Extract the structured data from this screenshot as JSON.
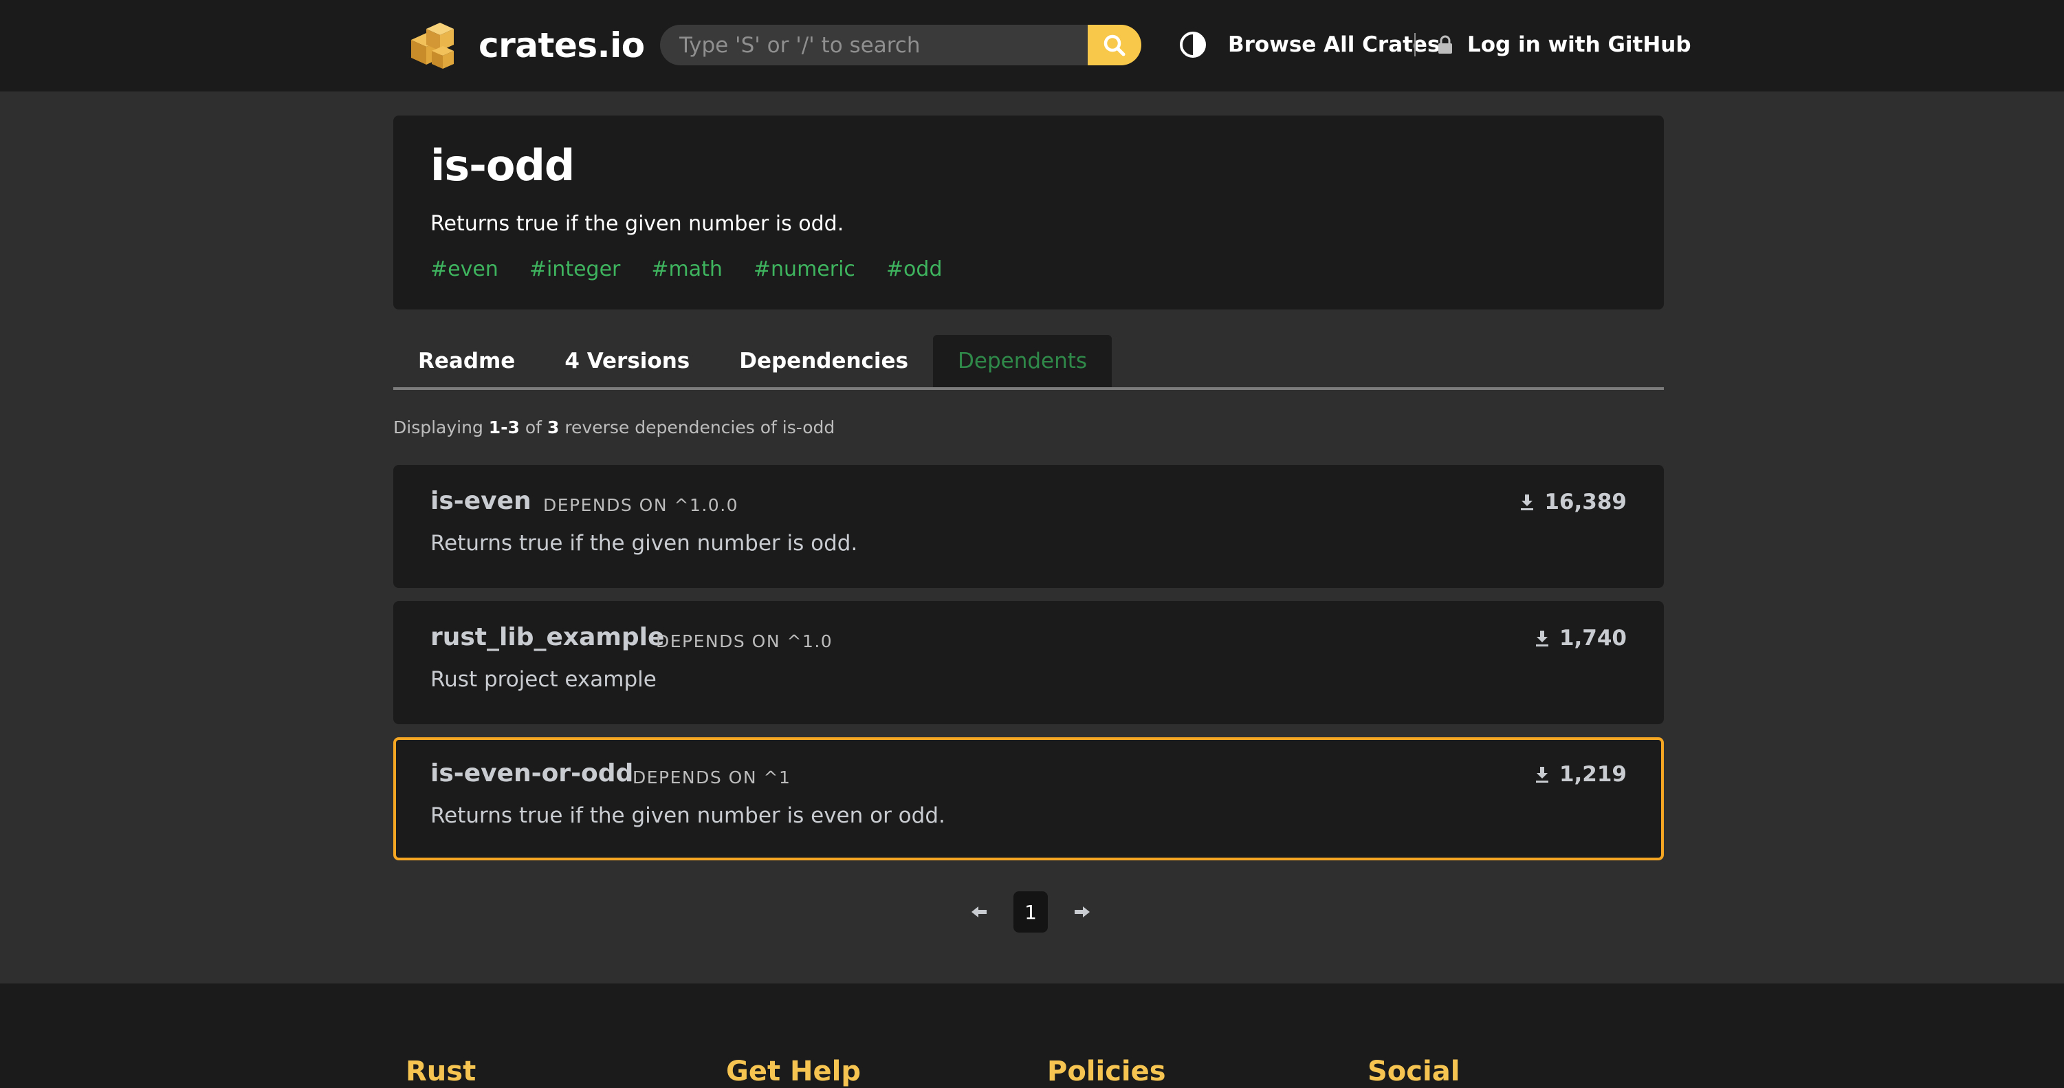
{
  "header": {
    "brand": "crates.io",
    "search_placeholder": "Type 'S' or '/' to search",
    "browse_label": "Browse All Crates",
    "login_label": "Log in with GitHub"
  },
  "crate": {
    "name": "is-odd",
    "description": "Returns true if the given number is odd.",
    "keywords": [
      "#even",
      "#integer",
      "#math",
      "#numeric",
      "#odd"
    ]
  },
  "tabs": [
    {
      "label": "Readme"
    },
    {
      "label": "4 Versions"
    },
    {
      "label": "Dependencies"
    },
    {
      "label": "Dependents",
      "active": true
    }
  ],
  "summary": {
    "prefix": "Displaying",
    "range": "1-3",
    "of": "of",
    "total": "3",
    "suffix": "reverse dependencies of is-odd"
  },
  "dependents": [
    {
      "name": "is-even",
      "requirement": "DEPENDS ON ^1.0.0",
      "description": "Returns true if the given number is odd.",
      "downloads": "16,389"
    },
    {
      "name": "rust_lib_example",
      "requirement": "DEPENDS ON ^1.0",
      "description": "Rust project example",
      "downloads": "1,740"
    },
    {
      "name": "is-even-or-odd",
      "requirement": "DEPENDS ON ^1",
      "description": "Returns true if the given number is even or odd.",
      "downloads": "1,219",
      "focused": true
    }
  ],
  "pagination": {
    "current_page": "1"
  },
  "footer": {
    "headings": [
      "Rust",
      "Get Help",
      "Policies",
      "Social"
    ]
  },
  "colors": {
    "accent": "#f7c84a",
    "keyword": "#3fb45f",
    "active_tab": "#2f8a4a",
    "focus_outline": "#f5a623",
    "footer_heading": "#f5c451"
  }
}
